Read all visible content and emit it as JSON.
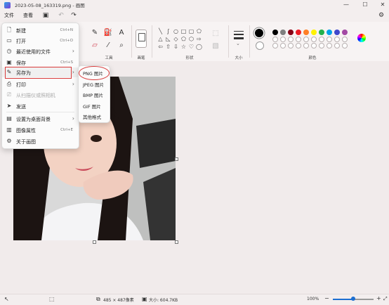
{
  "window": {
    "title": "2023-05-08_163319.png - 画图",
    "minimize": "—",
    "maximize": "☐",
    "close": "✕"
  },
  "menubar": {
    "file": "文件",
    "view": "查看"
  },
  "ribbon": {
    "groups": {
      "tools": "工具",
      "brushes": "画笔",
      "shapes": "形状",
      "size": "大小",
      "colors": "颜色"
    },
    "colors_row1": [
      "#000000",
      "#7f7f7f",
      "#880015",
      "#ed1c24",
      "#ff7f27",
      "#fff200",
      "#22b14c",
      "#00a2e8",
      "#3f48cc",
      "#a349a4"
    ],
    "colors_row2": [
      "#ffffff",
      "#c3c3c3",
      "#b97a57",
      "#ffaec9",
      "#ffc90e",
      "#efe4b0",
      "#b5e61d",
      "#99d9ea",
      "#7092be",
      "#c8bfe7"
    ]
  },
  "file_menu": {
    "items": [
      {
        "label": "新建",
        "shortcut": "Ctrl+N",
        "icon": "new-file-icon"
      },
      {
        "label": "打开",
        "shortcut": "Ctrl+O",
        "icon": "open-folder-icon"
      },
      {
        "label": "最近使用的文件",
        "icon": "recent-icon"
      },
      {
        "label": "保存",
        "shortcut": "Ctrl+S",
        "icon": "save-icon"
      },
      {
        "label": "另存为",
        "icon": "save-as-icon"
      },
      {
        "label": "打印",
        "icon": "print-icon"
      },
      {
        "label": "从扫描仪或照相机",
        "icon": "scanner-icon"
      },
      {
        "label": "发送",
        "icon": "send-icon"
      },
      {
        "label": "设置为桌面背景",
        "icon": "desktop-icon"
      },
      {
        "label": "图像属性",
        "shortcut": "Ctrl+E",
        "icon": "properties-icon"
      },
      {
        "label": "关于画图",
        "icon": "settings-icon"
      }
    ]
  },
  "save_as_menu": {
    "items": [
      "PNG 图片",
      "JPEG 图片",
      "BMP 图片",
      "GIF 图片",
      "其他格式"
    ]
  },
  "statusbar": {
    "dimensions": "485 × 487像素",
    "size": "大小: 604.7KB",
    "zoom": "100%",
    "zoom_level": 0.5
  }
}
